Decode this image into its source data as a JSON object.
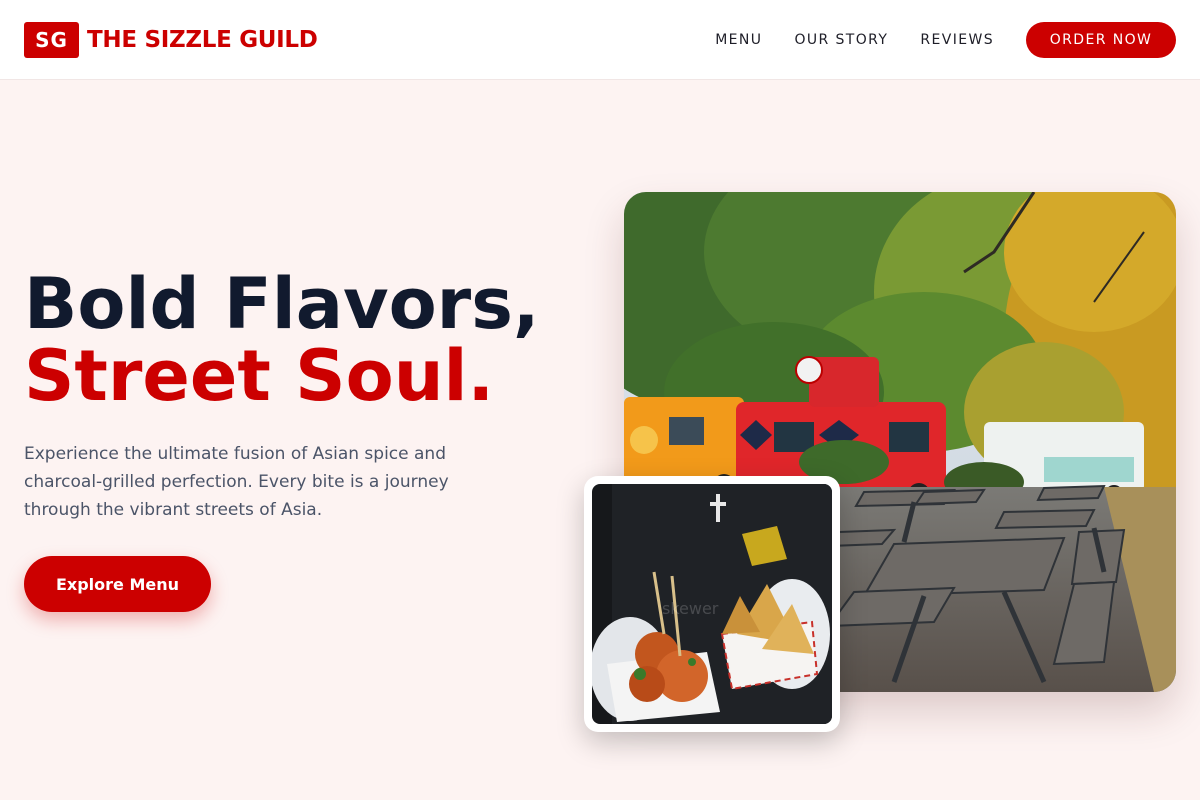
{
  "brand": {
    "badge": "SG",
    "name": "THE SIZZLE GUILD"
  },
  "nav": {
    "links": [
      "MENU",
      "OUR STORY",
      "REVIEWS"
    ],
    "order_button": "ORDER NOW"
  },
  "hero": {
    "title_line1": "Bold Flavors,",
    "title_line2": "Street Soul.",
    "description": "Experience the ultimate fusion of Asian spice and charcoal-grilled perfection. Every bite is a journey through the vibrant streets of Asia.",
    "cta": "Explore Menu"
  },
  "images": {
    "main_alt": "Food trucks parked near picnic tables under autumn trees",
    "secondary_alt": "Skewered meatballs and samosas held in paper trays"
  },
  "colors": {
    "accent": "#cc0000",
    "heading": "#111a2e",
    "body_text": "#4b5468",
    "background": "#fdf3f2"
  }
}
